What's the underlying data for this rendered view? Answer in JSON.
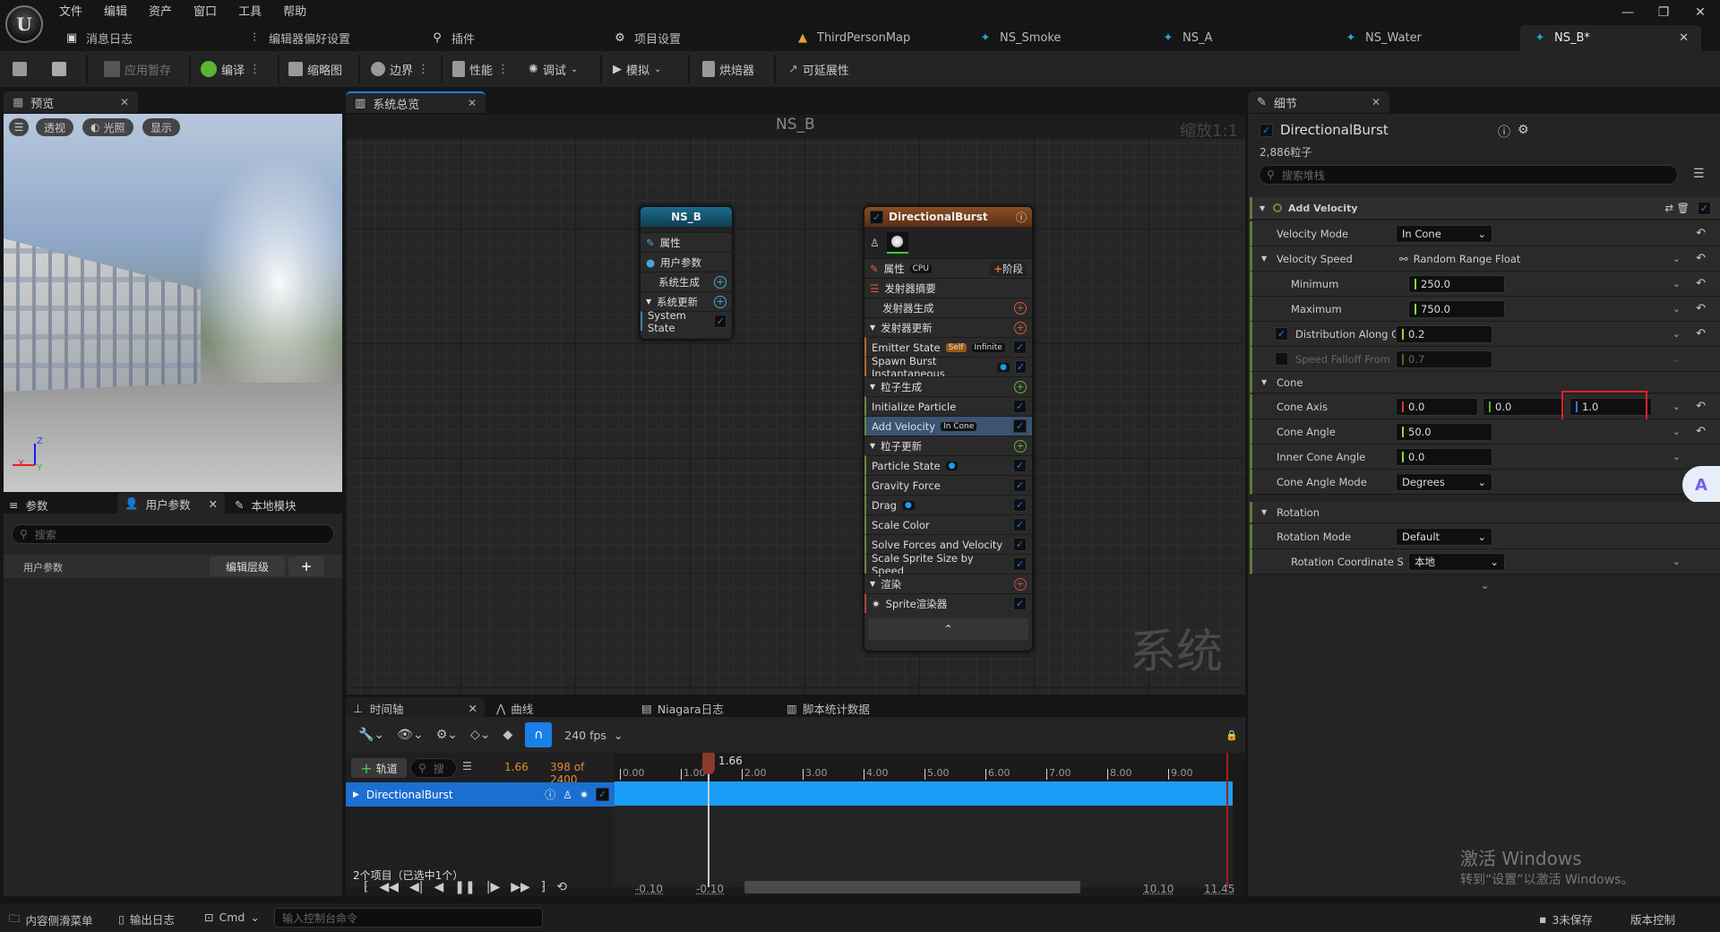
{
  "menu": [
    "文件",
    "编辑",
    "资产",
    "窗口",
    "工具",
    "帮助"
  ],
  "doc_tabs": [
    {
      "label": "消息日志",
      "icon": "message-log-icon"
    },
    {
      "label": "编辑器偏好设置",
      "icon": "sliders-icon"
    },
    {
      "label": "插件",
      "icon": "plugin-icon"
    },
    {
      "label": "项目设置",
      "icon": "project-settings-icon"
    },
    {
      "label": "ThirdPersonMap",
      "icon": "level-icon"
    },
    {
      "label": "NS_Smoke",
      "icon": "niagara-system-icon"
    },
    {
      "label": "NS_A",
      "icon": "niagara-system-icon"
    },
    {
      "label": "NS_Water",
      "icon": "niagara-system-icon"
    },
    {
      "label": "NS_B*",
      "icon": "niagara-system-icon"
    }
  ],
  "toolbar": {
    "apply": "应用暂存",
    "compile": "编译",
    "thumbnail": "缩略图",
    "bounds": "边界",
    "performance": "性能",
    "debug": "调试",
    "simulate": "模拟",
    "baker": "烘焙器",
    "scalability": "可延展性"
  },
  "preview": {
    "tab": "预览",
    "perspective": "透视",
    "lighting": "光照",
    "show": "显示",
    "axis": {
      "x": "X",
      "y": "Y",
      "z": "Z"
    }
  },
  "params": {
    "tabs": [
      "参数",
      "用户参数",
      "本地模块"
    ],
    "search_placeholder": "搜索",
    "section": "用户参数",
    "edit_hierarchy": "编辑层级",
    "add": "+"
  },
  "graph": {
    "tab": "系统总览",
    "title": "NS_B",
    "zoom": "缩放1:1",
    "watermark": "系统",
    "system_node": {
      "title": "NS_B",
      "rows": [
        "属性",
        "用户参数",
        "系统生成",
        "系统更新",
        "System State"
      ]
    },
    "emitter_node": {
      "title": "DirectionalBurst",
      "properties": "属性",
      "cpu": "CPU",
      "stage": "阶段",
      "summary": "发射器摘要",
      "emitter_spawn": "发射器生成",
      "emitter_update": "发射器更新",
      "emitter_state": "Emitter State",
      "self": "Self",
      "infinite": "Infinite",
      "spawn_burst": "Spawn Burst Instantaneous",
      "particle_spawn": "粒子生成",
      "init_particle": "Initialize Particle",
      "add_velocity": "Add Velocity",
      "in_cone": "In Cone",
      "particle_update": "粒子更新",
      "update_modules": [
        "Particle State",
        "Gravity Force",
        "Drag",
        "Scale Color",
        "Solve Forces and Velocity",
        "Scale Sprite Size by Speed"
      ],
      "render": "渲染",
      "sprite_renderer": "Sprite渲染器"
    }
  },
  "details": {
    "tab": "细节",
    "emitter": "DirectionalBurst",
    "particle_count": "2,886粒子",
    "search_placeholder": "搜索堆栈",
    "module": "Add Velocity",
    "rows": {
      "velocity_mode": {
        "label": "Velocity Mode",
        "value": "In Cone"
      },
      "velocity_speed": {
        "label": "Velocity Speed",
        "value": "Random Range Float"
      },
      "minimum": {
        "label": "Minimum",
        "value": "250.0"
      },
      "maximum": {
        "label": "Maximum",
        "value": "750.0"
      },
      "distribution": {
        "label": "Distribution Along C",
        "value": "0.2"
      },
      "speed_falloff": {
        "label": "Speed Falloff From",
        "value": "0.7"
      },
      "cone": {
        "label": "Cone"
      },
      "cone_axis": {
        "label": "Cone Axis",
        "x": "0.0",
        "y": "0.0",
        "z": "1.0"
      },
      "cone_angle": {
        "label": "Cone Angle",
        "value": "50.0"
      },
      "inner_cone_angle": {
        "label": "Inner Cone Angle",
        "value": "0.0"
      },
      "cone_angle_mode": {
        "label": "Cone Angle Mode",
        "value": "Degrees"
      },
      "rotation": {
        "label": "Rotation"
      },
      "rotation_mode": {
        "label": "Rotation Mode",
        "value": "Default"
      },
      "rotation_coord": {
        "label": "Rotation Coordinate S",
        "value": "本地"
      }
    }
  },
  "timeline": {
    "tabs": [
      "时间轴",
      "曲线",
      "Niagara日志",
      "脚本统计数据"
    ],
    "fps": "240 fps",
    "add_track": "轨道",
    "search_placeholder": "搜",
    "current_time": "1.66",
    "frame": "398 of 2400",
    "track": "DirectionalBurst",
    "ticks": [
      "0.00",
      "1.00",
      "2.00",
      "3.00",
      "4.00",
      "5.00",
      "6.00",
      "7.00",
      "8.00",
      "9.00"
    ],
    "playhead": "1.66",
    "items": "2个项目（已选中1个）",
    "range_start": "-0.10",
    "view_start": "-0.10",
    "view_end": "10.10",
    "range_end": "11.45"
  },
  "statusbar": {
    "content_drawer": "内容侧滑菜单",
    "output_log": "输出日志",
    "cmd": "Cmd",
    "console_placeholder": "输入控制台命令",
    "unsaved": "3未保存",
    "source_control": "版本控制"
  },
  "watermark": {
    "line1": "激活 Windows",
    "line2": "转到“设置”以激活 Windows。"
  }
}
